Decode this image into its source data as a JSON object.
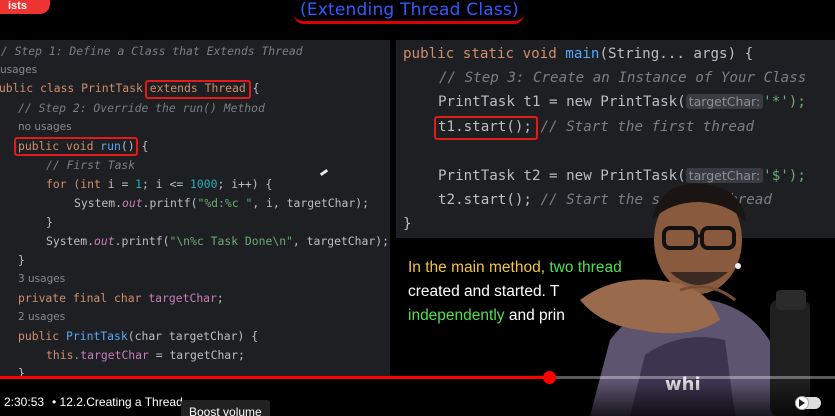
{
  "brand": {
    "chip_text": "ists"
  },
  "video": {
    "title_banner": "(Extending Thread Class)",
    "left_code": {
      "line1": "// Step 1: Define a Class that Extends Thread",
      "line2": "usages",
      "line3_a": "public class PrintTask ",
      "line3_b": "extends Thread",
      "line3_c": " {",
      "line4": "// Step 2: Override the run() Method",
      "line5": "no usages",
      "line6_a": "public void ",
      "line6_b": "run",
      "line6_c": "() {",
      "line7": "// First Task",
      "line8_a": "for (int ",
      "line8_b": "i",
      "line8_c": " = ",
      "line8_d": "1",
      "line8_e": "; ",
      "line8_f": " <= ",
      "line8_g": "1000",
      "line8_h": "; ",
      "line8_i": "++) {",
      "line9_a": "System.",
      "line9_b": "out",
      "line9_c": ".printf(",
      "line9_d": "\"%d:%c \"",
      "line9_e": ", i, targetChar);",
      "line10": "}",
      "line11_a": "System.",
      "line11_b": "out",
      "line11_c": ".printf(",
      "line11_d": "\"\\n%c Task Done\\n\"",
      "line11_e": ", targetChar);",
      "line12": "}",
      "line13": "3 usages",
      "line14_a": "private final char ",
      "line14_b": "targetChar",
      "line14_c": ";",
      "line15": "2 usages",
      "line16_a": "public ",
      "line16_b": "PrintTask",
      "line16_c": "(char targetChar) {",
      "line17_a": "this.",
      "line17_b": "targetChar",
      "line17_c": " = targetChar;",
      "line18": "}"
    },
    "right_code": {
      "line1_a": "public static void ",
      "line1_b": "main",
      "line1_c": "(String... args) {",
      "line2": "// Step 3: Create an Instance of Your Class",
      "line3_a": "PrintTask t1 = new PrintTask(",
      "line3_hint": "targetChar:",
      "line3_c": "'*');",
      "line4_a": "t1.start();",
      "line4_b": " // Start the first thread",
      "line5_a": "PrintTask t2 = new PrintTask(",
      "line5_hint": "targetChar:",
      "line5_c": "'$');",
      "line6_a": "t2.start();",
      "line6_b": " // Start the sec",
      "line6_c": "hread",
      "line7": "}"
    },
    "caption": {
      "p1": "In the main method, ",
      "p2": "two thread",
      "p3": "created and started. T",
      "p4": "independently",
      "p5": " and prin"
    }
  },
  "player": {
    "current_time": "2:30:53",
    "chapter_sep": "•",
    "chapter_title": "12.2.Creating a Thread",
    "tooltip": "Boost volume",
    "progress_percent": 65.8
  },
  "colors": {
    "accent": "#ff0000",
    "title_blue": "#2f5cff",
    "highlight_red": "#e01b1b"
  }
}
